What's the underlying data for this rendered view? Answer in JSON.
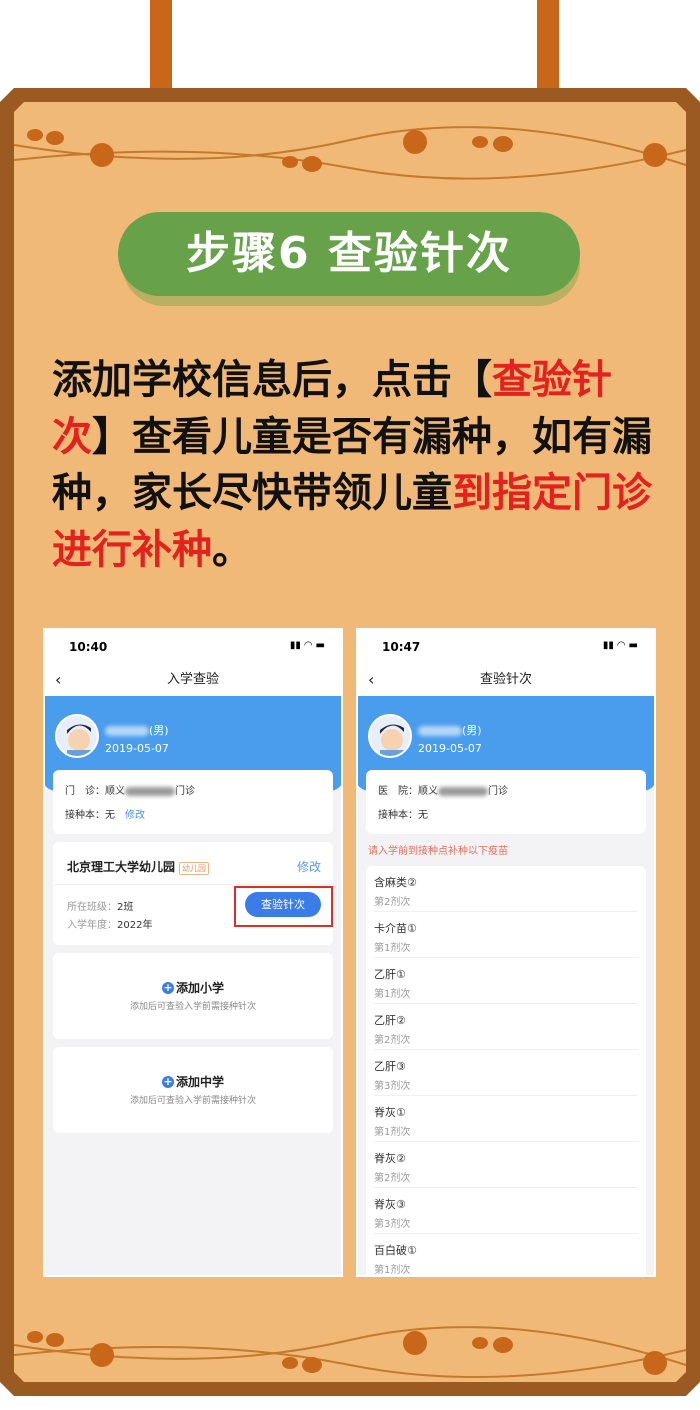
{
  "title": "步骤6 查验针次",
  "instruction": {
    "p1": "添加学校信息后，点击【",
    "r1": "查验针次",
    "p2": "】查看儿童是否有漏种，如有漏种，家长尽快带领儿童",
    "r2": "到指定门诊进行补种",
    "p3": "。"
  },
  "colors": {
    "board": "#f0b978",
    "border": "#9a5a22",
    "pill": "#67a24a",
    "highlight": "#e3211d",
    "app_blue": "#4a9cec"
  },
  "left_phone": {
    "time": "10:40",
    "nav_title": "入学查验",
    "gender": "(男)",
    "dob": "2019-05-07",
    "clinic_label": "门　诊：",
    "clinic_prefix": "顺义",
    "clinic_suffix": "门诊",
    "book_label": "接种本：",
    "book_value": "无",
    "edit": "修改",
    "school_name": "北京理工大学幼儿园",
    "school_tag": "幼儿园",
    "school_edit": "修改",
    "class_label": "所在班级：",
    "class_value": "2班",
    "year_label": "入学年度：",
    "year_value": "2022年",
    "check_button": "查验针次",
    "add_primary": "添加小学",
    "add_primary_sub": "添加后可查验入学前需接种针次",
    "add_middle": "添加中学",
    "add_middle_sub": "添加后可查验入学前需接种针次"
  },
  "right_phone": {
    "time": "10:47",
    "nav_title": "查验针次",
    "gender": "(男)",
    "dob": "2019-05-07",
    "hospital_label": "医　院：",
    "hospital_prefix": "顺义",
    "hospital_suffix": "门诊",
    "book_label": "接种本：",
    "book_value": "无",
    "warning": "请入学前到接种点补种以下疫苗",
    "vaccines": [
      {
        "name": "含麻类②",
        "dose": "第2剂次"
      },
      {
        "name": "卡介苗①",
        "dose": "第1剂次"
      },
      {
        "name": "乙肝①",
        "dose": "第1剂次"
      },
      {
        "name": "乙肝②",
        "dose": "第2剂次"
      },
      {
        "name": "乙肝③",
        "dose": "第3剂次"
      },
      {
        "name": "脊灰①",
        "dose": "第1剂次"
      },
      {
        "name": "脊灰②",
        "dose": "第2剂次"
      },
      {
        "name": "脊灰③",
        "dose": "第3剂次"
      },
      {
        "name": "百白破①",
        "dose": "第1剂次"
      }
    ]
  }
}
